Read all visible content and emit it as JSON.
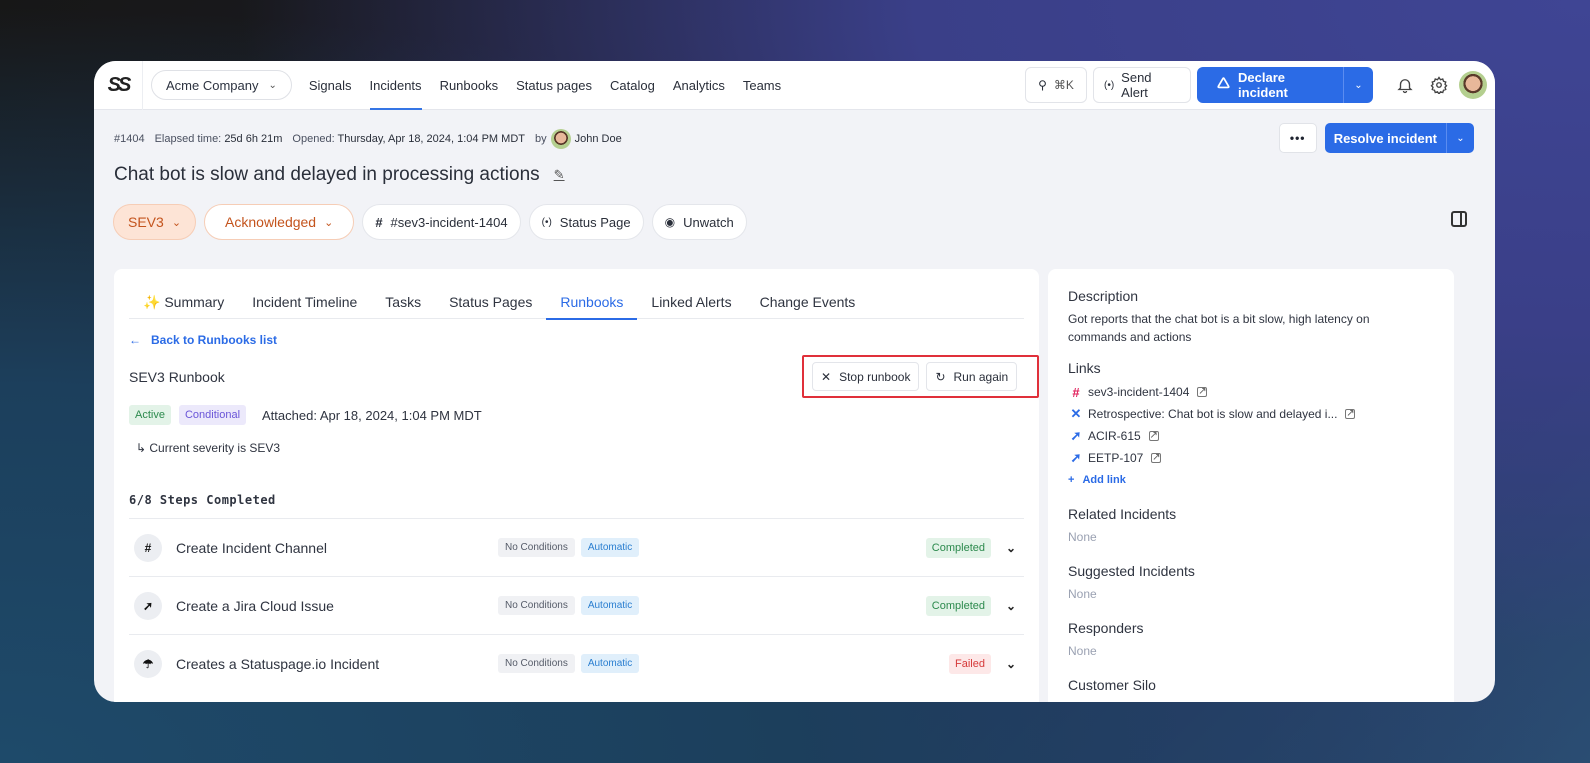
{
  "nav": {
    "logo": "SS",
    "org": "Acme Company",
    "links": [
      "Signals",
      "Incidents",
      "Runbooks",
      "Status pages",
      "Catalog",
      "Analytics",
      "Teams"
    ],
    "active_link": "Incidents",
    "search_shortcut": "⌘K",
    "send_alert": "Send Alert",
    "declare_incident": "Declare incident"
  },
  "incident": {
    "id": "#1404",
    "elapsed_label": "Elapsed time:",
    "elapsed": "25d 6h 21m",
    "opened_label": "Opened:",
    "opened": "Thursday, Apr 18, 2024, 1:04 PM MDT",
    "by_label": "by",
    "author": "John Doe",
    "title": "Chat bot is slow and delayed in processing actions",
    "severity": "SEV3",
    "status": "Acknowledged",
    "channel": "#sev3-incident-1404",
    "status_page": "Status Page",
    "watch": "Unwatch",
    "resolve": "Resolve incident",
    "more": "•••"
  },
  "tabs": [
    {
      "label": "✨ Summary"
    },
    {
      "label": "Incident Timeline"
    },
    {
      "label": "Tasks"
    },
    {
      "label": "Status Pages"
    },
    {
      "label": "Runbooks",
      "active": true
    },
    {
      "label": "Linked Alerts"
    },
    {
      "label": "Change Events"
    }
  ],
  "runbook": {
    "back": "Back to Runbooks list",
    "title": "SEV3 Runbook",
    "stop": "Stop runbook",
    "run_again": "Run again",
    "badge_active": "Active",
    "badge_conditional": "Conditional",
    "attached": "Attached: Apr 18, 2024, 1:04 PM MDT",
    "condition": "↳ Current severity is SEV3",
    "steps_completed": "6/8 Steps Completed",
    "steps": [
      {
        "name": "Create Incident Channel",
        "icon": "slack-icon",
        "conditions": "No Conditions",
        "mode": "Automatic",
        "status": "Completed"
      },
      {
        "name": "Create a Jira Cloud Issue",
        "icon": "jira-icon",
        "conditions": "No Conditions",
        "mode": "Automatic",
        "status": "Completed"
      },
      {
        "name": "Creates a Statuspage.io Incident",
        "icon": "statuspage-icon",
        "conditions": "No Conditions",
        "mode": "Automatic",
        "status": "Failed"
      }
    ]
  },
  "side": {
    "description_h": "Description",
    "description": "Got reports that the chat bot is a bit slow, high latency on commands and actions",
    "links_h": "Links",
    "links": [
      {
        "label": "sev3-incident-1404",
        "icon": "slack-icon"
      },
      {
        "label": "Retrospective: Chat bot is slow and delayed i...",
        "icon": "confluence-icon"
      },
      {
        "label": "ACIR-615",
        "icon": "jira-icon"
      },
      {
        "label": "EETP-107",
        "icon": "jira-icon"
      }
    ],
    "add_link": "Add link",
    "related_h": "Related Incidents",
    "related": "None",
    "suggested_h": "Suggested Incidents",
    "suggested": "None",
    "responders_h": "Responders",
    "responders": "None",
    "customer_h": "Customer Silo"
  },
  "colors": {
    "accent": "#2b6be6",
    "sev": "#c4541d",
    "completed": "#2c8a4d",
    "failed": "#d63a3a",
    "highlight": "#e0303a"
  }
}
